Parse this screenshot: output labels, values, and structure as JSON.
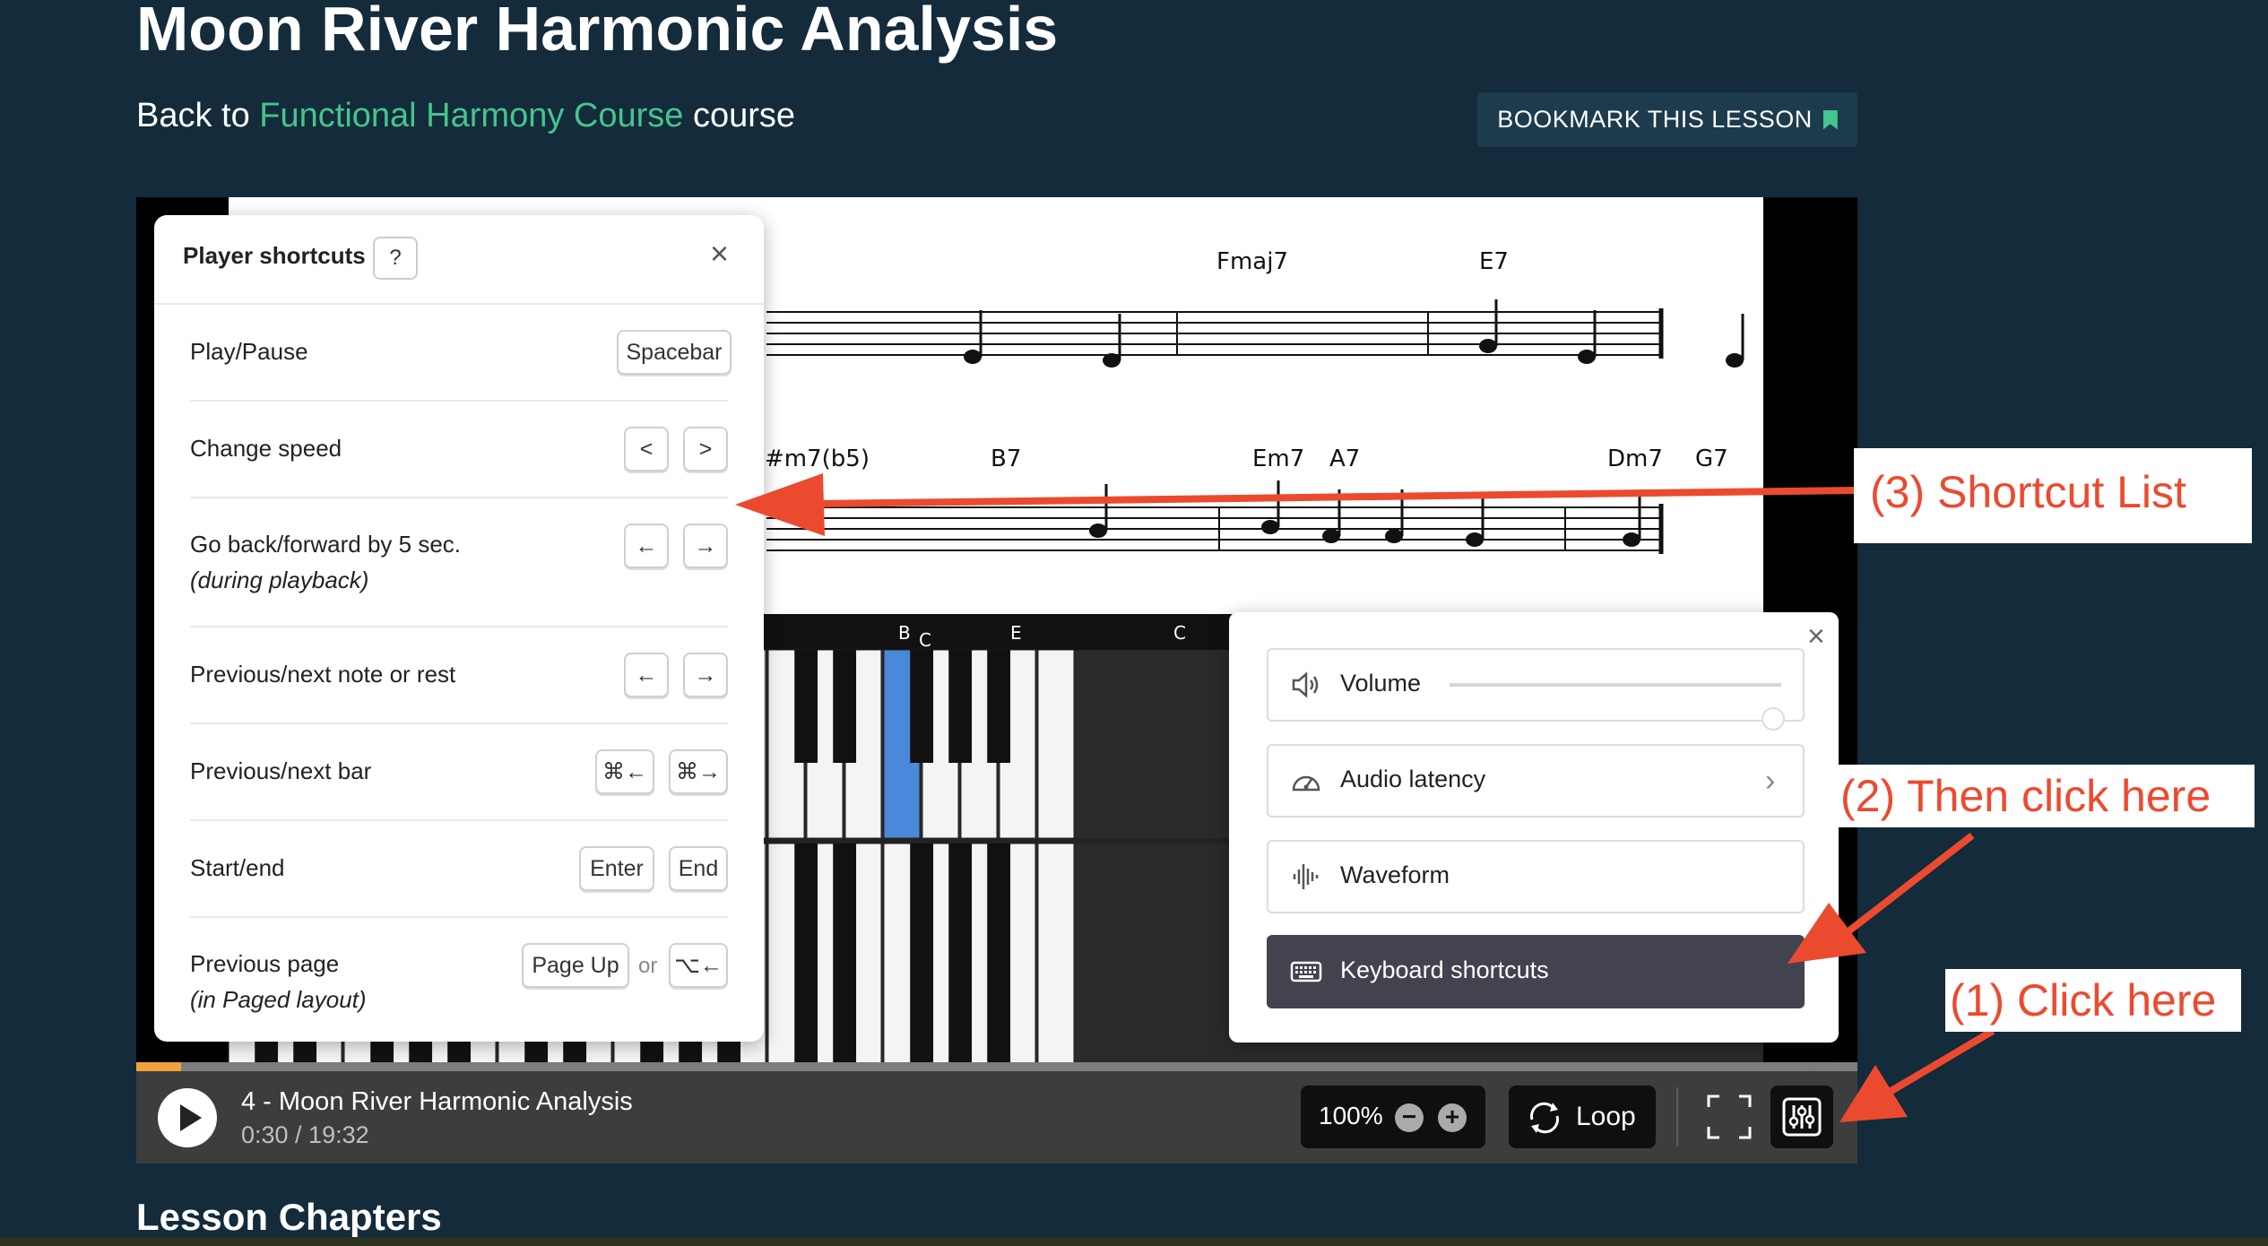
{
  "page": {
    "title": "Moon River Harmonic Analysis",
    "back_prefix": "Back to",
    "back_link": "Functional Harmony Course",
    "back_suffix": "course",
    "bookmark_label": "BOOKMARK THIS LESSON",
    "chapters_heading": "Lesson Chapters"
  },
  "sheet": {
    "chords_row1": [
      "Fmaj7",
      "E7"
    ],
    "chords_row2": [
      "#m7(b5)",
      "B7",
      "Em7",
      "A7",
      "Dm7",
      "G7"
    ]
  },
  "piano": {
    "labels": [
      "B",
      "C",
      "E",
      "C"
    ]
  },
  "player": {
    "video_title": "4 - Moon River Harmonic Analysis",
    "time": "0:30 / 19:32",
    "progress": 0.026,
    "speed": "100%",
    "speed_minus": "−",
    "speed_plus": "+",
    "loop_label": "Loop"
  },
  "shortcuts": {
    "title": "Player shortcuts",
    "help": "?",
    "close": "×",
    "or": "or",
    "rows": [
      {
        "label": "Play/Pause",
        "keys": [
          "Spacebar"
        ]
      },
      {
        "label": "Change speed",
        "keys": [
          "<",
          ">"
        ]
      },
      {
        "label": "Go back/forward by 5 sec.",
        "sub": "(during playback)",
        "keys": [
          "←",
          "→"
        ]
      },
      {
        "label": "Previous/next note or rest",
        "keys": [
          "←",
          "→"
        ]
      },
      {
        "label": "Previous/next bar",
        "keys": [
          "⌘←",
          "⌘→"
        ]
      },
      {
        "label": "Start/end",
        "keys": [
          "Enter",
          "End"
        ]
      },
      {
        "label": "Previous page",
        "sub": "(in Paged layout)",
        "keys": [
          "Page Up",
          "⌥←"
        ]
      }
    ]
  },
  "settings": {
    "close": "×",
    "volume_label": "Volume",
    "volume_level": 0.97,
    "latency_label": "Audio latency",
    "latency_chevron": "›",
    "waveform_label": "Waveform",
    "keyboard_label": "Keyboard shortcuts"
  },
  "annotations": {
    "step3": "(3) Shortcut List",
    "step2": "(2) Then click here",
    "step1": "(1) Click here",
    "color": "#ec4a2f"
  },
  "colors": {
    "background": "#132b3a",
    "link": "#45c48e",
    "highlight_key": "#4a88d9"
  }
}
